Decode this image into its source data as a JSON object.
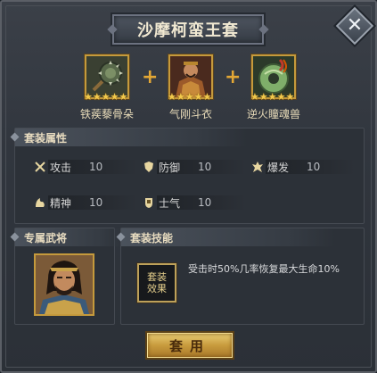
{
  "title": "沙摩柯蛮王套",
  "close_glyph": "✕",
  "items": [
    {
      "name": "铁蒺藜骨朵",
      "stars": "★★★★★",
      "icon": "spiked-mace-icon"
    },
    {
      "name": "气刚斗衣",
      "stars": "★★★★★",
      "icon": "armor-icon"
    },
    {
      "name": "逆火瞳魂兽",
      "stars": "★★★★★",
      "icon": "jade-beast-icon"
    }
  ],
  "plus_glyph": "+",
  "attributes_section": {
    "title": "套装属性",
    "attributes": [
      {
        "label": "攻击",
        "value": "10",
        "icon": "crossed-swords-icon"
      },
      {
        "label": "防御",
        "value": "10",
        "icon": "shield-icon"
      },
      {
        "label": "爆发",
        "value": "10",
        "icon": "burst-icon"
      },
      {
        "label": "精神",
        "value": "10",
        "icon": "spirit-icon"
      },
      {
        "label": "士气",
        "value": "10",
        "icon": "morale-icon"
      }
    ]
  },
  "general_section": {
    "title": "专属武将"
  },
  "skill_section": {
    "title": "套装技能",
    "icon_label_line1": "套装",
    "icon_label_line2": "效果",
    "description": "受击时50%几率恢复最大生命10%"
  },
  "apply_button": "套用",
  "colors": {
    "gold": "#c59a3c",
    "star": "#f2c94c",
    "panel": "#31363e"
  }
}
